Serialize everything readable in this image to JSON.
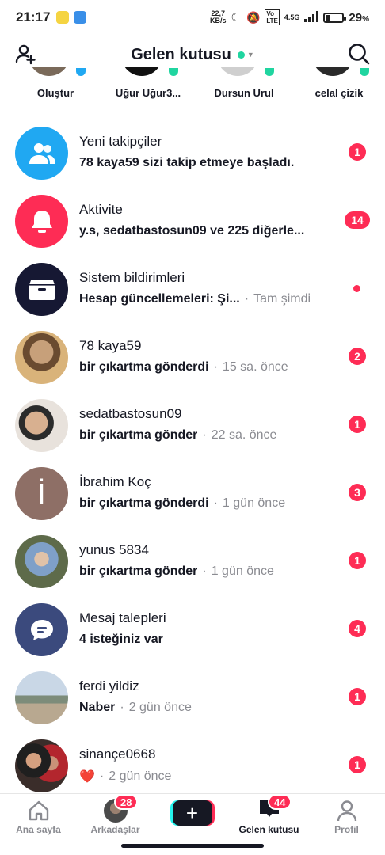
{
  "status_bar": {
    "time": "21:17",
    "net_speed_top": "22,7",
    "net_speed_bottom": "KB/s",
    "signal_label": "4.5G",
    "battery_percent": "29",
    "battery_unit": "%",
    "battery_level": 0.29
  },
  "header": {
    "title": "Gelen kutusu",
    "add_friends_icon": "add-user-icon",
    "search_icon": "search-icon"
  },
  "stories": [
    {
      "name": "Oluştur"
    },
    {
      "name": "Uğur Uğur3..."
    },
    {
      "name": "Dursun Urul"
    },
    {
      "name": "celal çizik"
    }
  ],
  "inbox": [
    {
      "title": "Yeni takipçiler",
      "message": "78 kaya59 sizi takip etmeye başladı.",
      "time": "",
      "badge": "1",
      "icon": "followers-icon",
      "color": "#20a8f2"
    },
    {
      "title": "Aktivite",
      "message": "y.s, sedatbastosun09 ve 225 diğerle...",
      "time": "",
      "badge": "14",
      "icon": "bell-icon",
      "color": "#fe2c55"
    },
    {
      "title": "Sistem bildirimleri",
      "message": "Hesap güncellemeleri: Şi...",
      "time": "Tam şimdi",
      "badge": "",
      "icon": "inbox-tray-icon",
      "color": "#161833"
    },
    {
      "title": "78 kaya59",
      "message": "bir çıkartma gönderdi",
      "time": "15 sa. önce",
      "badge": "2",
      "icon": "avatar",
      "color": "#b08a5a"
    },
    {
      "title": "sedatbastosun09",
      "message": "bir çıkartma gönder",
      "time": "22 sa. önce",
      "badge": "1",
      "icon": "avatar",
      "color": "#8a6a58"
    },
    {
      "title": "İbrahim Koç",
      "message": "bir çıkartma gönderdi",
      "time": "1 gün önce",
      "badge": "3",
      "icon": "avatar-letter",
      "letter": "İ",
      "color": "#8e6f66"
    },
    {
      "title": "yunus 5834",
      "message": "bir çıkartma gönder",
      "time": "1 gün önce",
      "badge": "1",
      "icon": "avatar",
      "color": "#5f6b58"
    },
    {
      "title": "Mesaj talepleri",
      "message": "4 isteğiniz var",
      "time": "",
      "badge": "4",
      "icon": "chat-bubble-icon",
      "color": "#3b4a7d"
    },
    {
      "title": "ferdi yildiz",
      "message": "Naber",
      "time": "2 gün önce",
      "badge": "1",
      "icon": "avatar",
      "color": "#9fb3c4"
    },
    {
      "title": "sinançe0668",
      "message": "❤️",
      "time": "2 gün önce",
      "badge": "1",
      "icon": "avatar",
      "color": "#4a3a38"
    }
  ],
  "bottom_nav": [
    {
      "label": "Ana sayfa",
      "icon": "home-icon",
      "badge": ""
    },
    {
      "label": "Arkadaşlar",
      "icon": "friends-avatar",
      "badge": "28"
    },
    {
      "label": "",
      "icon": "create-plus-icon",
      "badge": ""
    },
    {
      "label": "Gelen kutusu",
      "icon": "inbox-icon",
      "badge": "44"
    },
    {
      "label": "Profil",
      "icon": "profile-icon",
      "badge": ""
    }
  ]
}
